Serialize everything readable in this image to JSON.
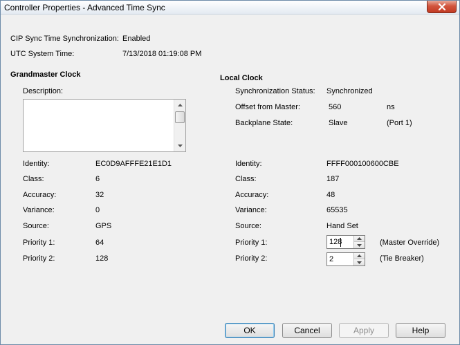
{
  "window": {
    "title": "Controller Properties - Advanced Time Sync"
  },
  "sync": {
    "cip_label": "CIP Sync Time Synchronization:",
    "cip_value": "Enabled",
    "utc_label": "UTC System Time:",
    "utc_value": "7/13/2018 01:19:08 PM"
  },
  "grandmaster": {
    "heading": "Grandmaster Clock",
    "description_label": "Description:",
    "description_value": "",
    "fields": [
      {
        "label": "Identity:",
        "value": "EC0D9AFFFE21E1D1"
      },
      {
        "label": "Class:",
        "value": "6"
      },
      {
        "label": "Accuracy:",
        "value": "32"
      },
      {
        "label": "Variance:",
        "value": "0"
      },
      {
        "label": "Source:",
        "value": "GPS"
      },
      {
        "label": "Priority 1:",
        "value": "64"
      },
      {
        "label": "Priority 2:",
        "value": "128"
      }
    ]
  },
  "local": {
    "heading": "Local Clock",
    "sync_status_label": "Synchronization Status:",
    "sync_status_value": "Synchronized",
    "offset_label": "Offset from Master:",
    "offset_value": "560",
    "offset_unit": "ns",
    "backplane_label": "Backplane State:",
    "backplane_value": "Slave",
    "backplane_port": "(Port 1)",
    "fields": [
      {
        "label": "Identity:",
        "value": "FFFF000100600CBE"
      },
      {
        "label": "Class:",
        "value": "187"
      },
      {
        "label": "Accuracy:",
        "value": "48"
      },
      {
        "label": "Variance:",
        "value": "65535"
      },
      {
        "label": "Source:",
        "value": "Hand Set"
      }
    ],
    "priority1_label": "Priority 1:",
    "priority1_value": "128",
    "priority1_note": "(Master Override)",
    "priority2_label": "Priority 2:",
    "priority2_value": "2",
    "priority2_note": "(Tie Breaker)"
  },
  "buttons": {
    "ok": "OK",
    "cancel": "Cancel",
    "apply": "Apply",
    "help": "Help"
  },
  "colors": {
    "close_button": "#c23a22",
    "dialog_background": "#f0f0f0",
    "default_button_border": "#3c7fb1"
  },
  "icons": {
    "close": "close-icon",
    "scroll_up": "arrow-up-icon",
    "scroll_down": "arrow-down-icon",
    "spin_up": "spin-up-icon",
    "spin_down": "spin-down-icon"
  }
}
